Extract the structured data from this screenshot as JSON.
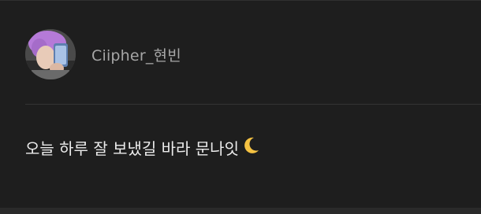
{
  "post": {
    "author": {
      "username": "Ciipher_현빈",
      "avatar_icon": "profile-photo-avatar"
    },
    "message": {
      "text": "오늘 하루 잘 보냈길 바라 문나잇",
      "emoji": "crescent-moon-icon"
    }
  },
  "colors": {
    "background": "#1e1e1e",
    "username": "#a6a6a6",
    "message_text": "#ececec",
    "avatar_hair": "#b57ad8",
    "moon": "#f5c242"
  }
}
